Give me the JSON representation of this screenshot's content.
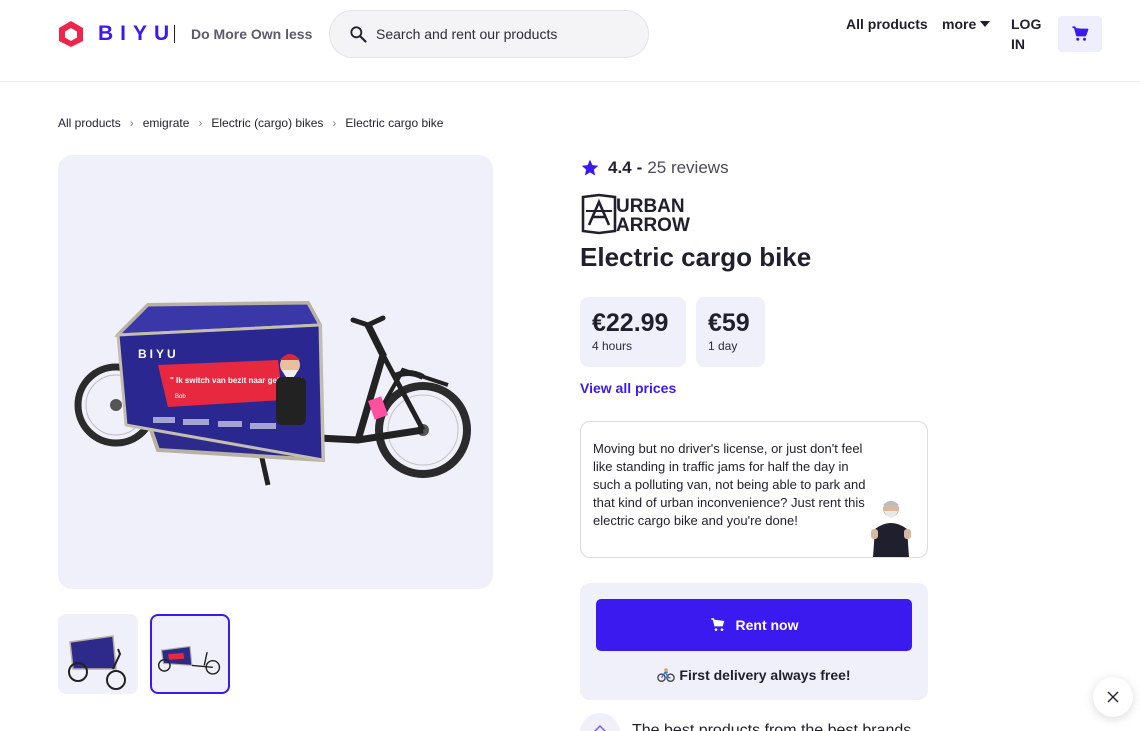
{
  "header": {
    "logo_text": "BIYU",
    "tagline": "Do More Own less",
    "search_placeholder": "Search and rent our products",
    "nav": {
      "all_products": "All products",
      "more": "more",
      "login": "LOG IN"
    }
  },
  "breadcrumb": [
    "All products",
    "emigrate",
    "Electric (cargo) bikes",
    "Electric cargo bike"
  ],
  "product": {
    "rating": "4.4",
    "rating_separator": "-",
    "reviews": "25 reviews",
    "brand_logo_lines": [
      "URBAN",
      "ARROW"
    ],
    "title": "Electric cargo bike",
    "prices": [
      {
        "amount": "€22.99",
        "period": "4 hours"
      },
      {
        "amount": "€59",
        "period": "1 day"
      }
    ],
    "view_all_prices": "View all prices",
    "description": "Moving but no driver's license, or just don't feel like standing in traffic jams for half the day in such a polluting van, not being able to park and that kind of urban inconvenience? Just rent this electric cargo bike and you're done!",
    "box_print": {
      "brand": "BIYU",
      "quote": "\" Ik switch van bezit naar gebruik \"",
      "quote_author": "Bob"
    }
  },
  "rent": {
    "button_label": "Rent now",
    "delivery_note": "First delivery always free!"
  },
  "bottom_text": "The best products from the best brands",
  "colors": {
    "accent": "#3a1aee",
    "logo_red": "#f0254b",
    "panel_bg": "#f0f0fb"
  },
  "icons": {
    "search": "search-icon",
    "cart": "cart-icon",
    "star": "star-icon",
    "close": "close-icon",
    "bike": "bicycle-icon"
  }
}
